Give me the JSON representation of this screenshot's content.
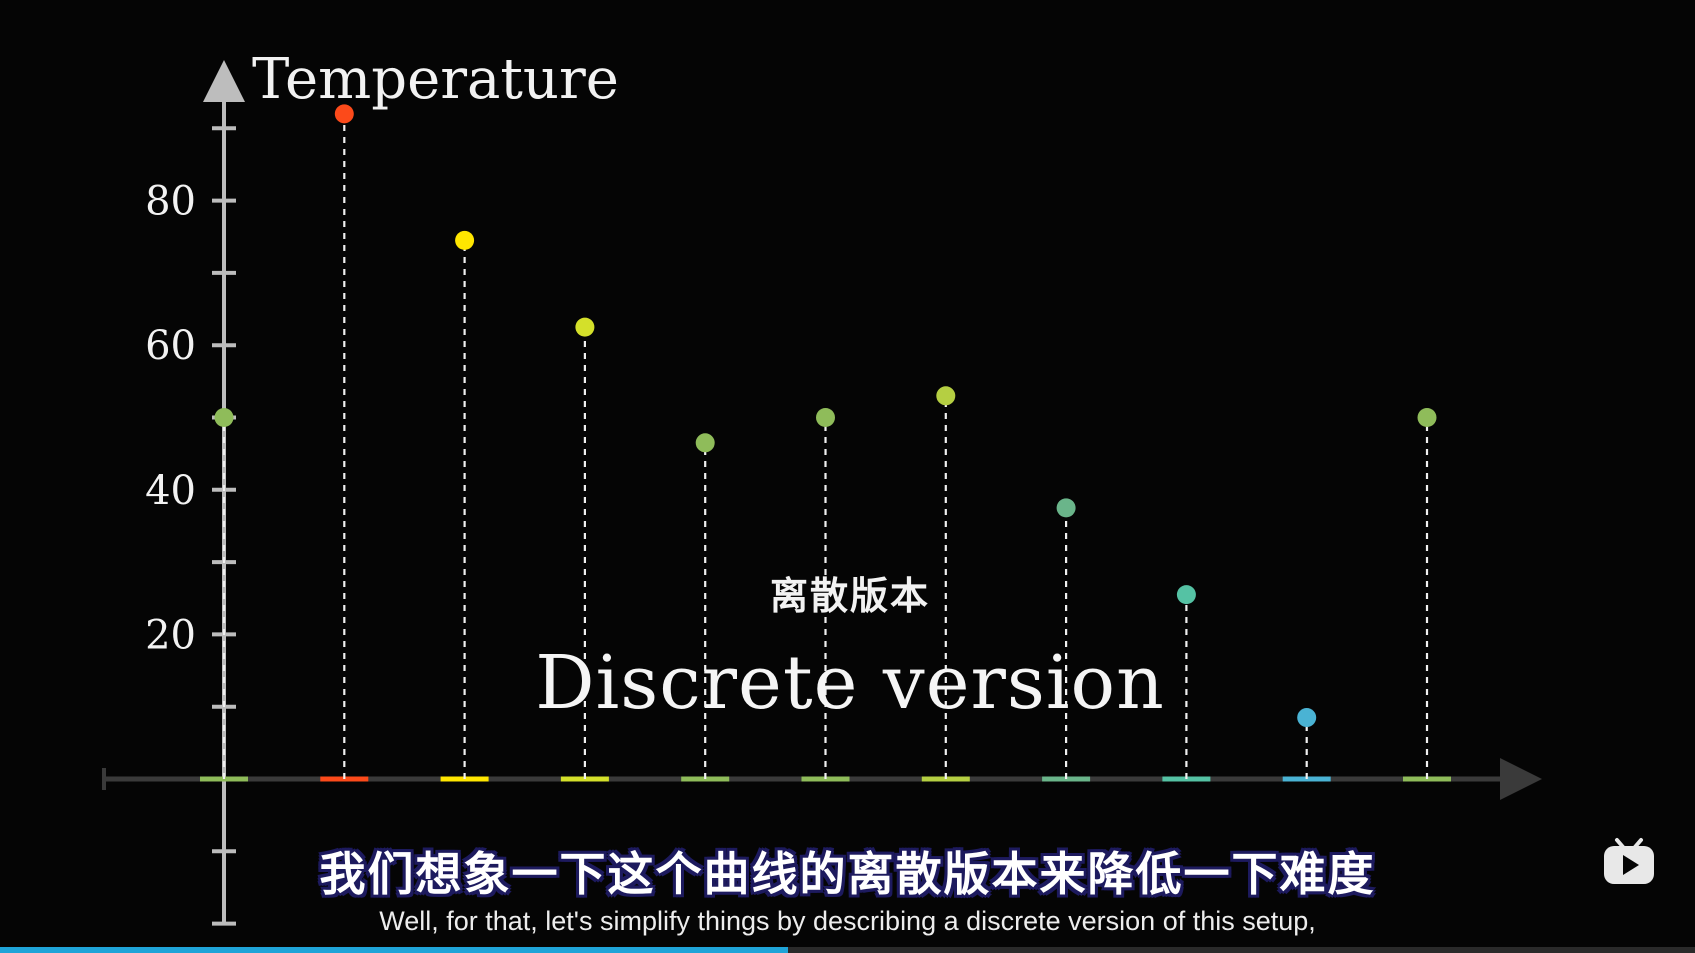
{
  "video": {
    "subtitle_cn": "我们想象一下这个曲线的离散版本来降低一下难度",
    "subtitle_en": "Well, for that, let's simplify things by describing a discrete version of this setup,",
    "overlay_cn": "离散版本",
    "overlay_en": "Discrete version",
    "progress": 0.465,
    "progress_color": "#1fa4d8",
    "logo_icon": "bilibili-tv-icon"
  },
  "chart_data": {
    "type": "scatter",
    "style": "stem",
    "ylabel": "Temperature",
    "y_ticks": [
      20,
      40,
      60,
      80
    ],
    "y_tick_labels": [
      "20",
      "40",
      "60",
      "80"
    ],
    "y_minor_ticks": [
      -20,
      -10,
      10,
      30,
      50,
      70,
      90
    ],
    "ylim": [
      -20,
      95
    ],
    "x_indices": [
      0,
      1,
      2,
      3,
      4,
      5,
      6,
      7,
      8,
      9,
      10
    ],
    "values": [
      50,
      92,
      74.5,
      62.5,
      46.5,
      50,
      53,
      37.5,
      25.5,
      8.5,
      50
    ],
    "colors": [
      "#8fbc5a",
      "#fc4a1a",
      "#ffe600",
      "#d4e02a",
      "#8fbc5a",
      "#8fbc5a",
      "#b5cf42",
      "#6ab58a",
      "#55c2a4",
      "#4ab3d4",
      "#8fbc5a"
    ],
    "grid": false,
    "legend": "none"
  }
}
